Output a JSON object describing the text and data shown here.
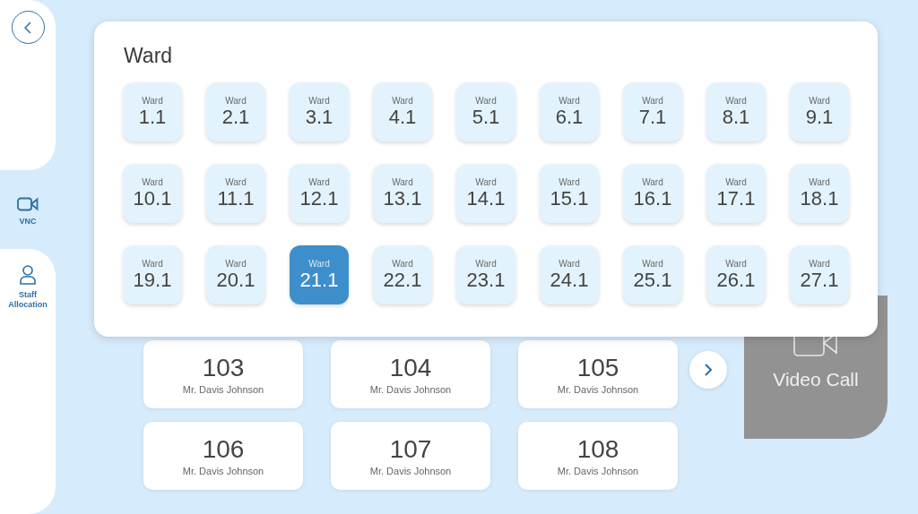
{
  "sidebar": {
    "items": [
      {
        "label": "VNC",
        "kind": "camera",
        "selected": true
      },
      {
        "label": "Staff Allocation",
        "kind": "person",
        "selected": false
      }
    ]
  },
  "beds": [
    {
      "number": "103",
      "patient": "Mr. Davis Johnson"
    },
    {
      "number": "104",
      "patient": "Mr. Davis Johnson"
    },
    {
      "number": "105",
      "patient": "Mr. Davis Johnson"
    },
    {
      "number": "106",
      "patient": "Mr. Davis Johnson"
    },
    {
      "number": "107",
      "patient": "Mr. Davis Johnson"
    },
    {
      "number": "108",
      "patient": "Mr. Davis Johnson"
    }
  ],
  "video_call": {
    "label": "Video Call"
  },
  "ward_picker": {
    "title": "Ward",
    "wards": [
      {
        "label": "Ward",
        "number": "1.1",
        "selected": false
      },
      {
        "label": "Ward",
        "number": "2.1",
        "selected": false
      },
      {
        "label": "Ward",
        "number": "3.1",
        "selected": false
      },
      {
        "label": "Ward",
        "number": "4.1",
        "selected": false
      },
      {
        "label": "Ward",
        "number": "5.1",
        "selected": false
      },
      {
        "label": "Ward",
        "number": "6.1",
        "selected": false
      },
      {
        "label": "Ward",
        "number": "7.1",
        "selected": false
      },
      {
        "label": "Ward",
        "number": "8.1",
        "selected": false
      },
      {
        "label": "Ward",
        "number": "9.1",
        "selected": false
      },
      {
        "label": "Ward",
        "number": "10.1",
        "selected": false
      },
      {
        "label": "Ward",
        "number": "11.1",
        "selected": false
      },
      {
        "label": "Ward",
        "number": "12.1",
        "selected": false
      },
      {
        "label": "Ward",
        "number": "13.1",
        "selected": false
      },
      {
        "label": "Ward",
        "number": "14.1",
        "selected": false
      },
      {
        "label": "Ward",
        "number": "15.1",
        "selected": false
      },
      {
        "label": "Ward",
        "number": "16.1",
        "selected": false
      },
      {
        "label": "Ward",
        "number": "17.1",
        "selected": false
      },
      {
        "label": "Ward",
        "number": "18.1",
        "selected": false
      },
      {
        "label": "Ward",
        "number": "19.1",
        "selected": false
      },
      {
        "label": "Ward",
        "number": "20.1",
        "selected": false
      },
      {
        "label": "Ward",
        "number": "21.1",
        "selected": true
      },
      {
        "label": "Ward",
        "number": "22.1",
        "selected": false
      },
      {
        "label": "Ward",
        "number": "23.1",
        "selected": false
      },
      {
        "label": "Ward",
        "number": "24.1",
        "selected": false
      },
      {
        "label": "Ward",
        "number": "25.1",
        "selected": false
      },
      {
        "label": "Ward",
        "number": "26.1",
        "selected": false
      },
      {
        "label": "Ward",
        "number": "27.1",
        "selected": false
      }
    ]
  }
}
